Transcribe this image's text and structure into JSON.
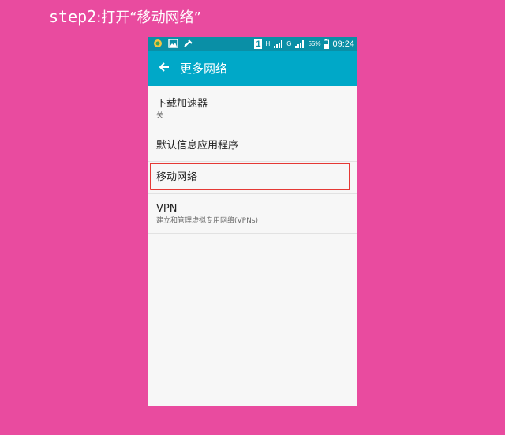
{
  "caption": {
    "prefix": "step2",
    "text": ":打开“移动网络”"
  },
  "status_bar": {
    "sim_slot": "1",
    "net_h": "H",
    "net_g": "G",
    "battery": "55%",
    "time": "09:24",
    "icons": [
      "app-notification-icon",
      "image-notification-icon",
      "tools-notification-icon",
      "sim-icon",
      "signal-icon",
      "battery-icon"
    ]
  },
  "app_bar": {
    "title": "更多网络",
    "back_icon": "arrow-left-icon"
  },
  "settings": [
    {
      "title": "下载加速器",
      "subtitle": "关"
    },
    {
      "title": "默认信息应用程序"
    },
    {
      "title": "移动网络"
    },
    {
      "title": "VPN",
      "subtitle": "建立和管理虚拟专用网络(VPNs)"
    }
  ],
  "colors": {
    "background": "#e94b9f",
    "status_bar": "#0a8fa6",
    "app_bar": "#00a8c8",
    "highlight": "#e53935"
  }
}
